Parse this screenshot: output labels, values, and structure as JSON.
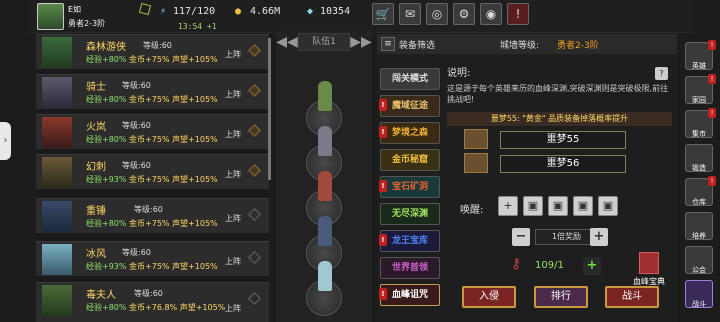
{
  "player": {
    "name": "E如",
    "rank": "勇者2-3阶",
    "stamina": "117/120",
    "gold": "4.66M",
    "gems": "10354",
    "timer": "13:54",
    "regen": "+1"
  },
  "top_icons": [
    "shop-cart-icon",
    "mail-icon",
    "gamepad-icon",
    "gear-icon",
    "color-wheel-icon",
    "notice-icon"
  ],
  "heroes": [
    {
      "name": "森林游侠",
      "level": "等级:60",
      "exp": "经验+80%",
      "gold": "金币+75%",
      "fame": "声望+105%",
      "action": "上阵",
      "active": true
    },
    {
      "name": "骑士",
      "level": "等级:60",
      "exp": "经验+80%",
      "gold": "金币+75%",
      "fame": "声望+105%",
      "action": "上阵",
      "active": true
    },
    {
      "name": "火岚",
      "level": "等级:60",
      "exp": "经验+80%",
      "gold": "金币+75%",
      "fame": "声望+105%",
      "action": "上阵",
      "active": true
    },
    {
      "name": "幻刺",
      "level": "等级:60",
      "exp": "经验+93%",
      "gold": "金币+75%",
      "fame": "声望+105%",
      "action": "上阵",
      "active": true
    },
    {
      "name": "重锤",
      "level": "等级:60",
      "exp": "经验+80%",
      "gold": "金币+75%",
      "fame": "声望+105%",
      "action": "上阵",
      "active": false
    },
    {
      "name": "冰风",
      "level": "等级:60",
      "exp": "经验+93%",
      "gold": "金币+75%",
      "fame": "声望+105%",
      "action": "上阵",
      "active": false
    },
    {
      "name": "毒夫人",
      "level": "等级:60",
      "exp": "经验+80%",
      "gold": "金币+76.8%",
      "fame": "声望+105%",
      "action": "上阵",
      "active": false
    }
  ],
  "team": {
    "label": "队伍1",
    "prev": "◀◀",
    "next": "▶▶"
  },
  "filter": {
    "title": "装备筛选",
    "castle_label": "城墙等级:",
    "castle_value": "勇者2-3阶"
  },
  "modes": [
    {
      "label": "闯关模式",
      "color": "#e0e0e0",
      "bg": "#3a3a3a",
      "badge": false
    },
    {
      "label": "魔域征途",
      "color": "#e8c070",
      "bg": "#3a2a1a",
      "badge": true
    },
    {
      "label": "梦境之森",
      "color": "#f0b030",
      "bg": "#3a2a14",
      "badge": true
    },
    {
      "label": "金币秘窟",
      "color": "#f0c040",
      "bg": "#3a3014",
      "badge": false
    },
    {
      "label": "宝石矿洞",
      "color": "#e06030",
      "bg": "#1a3a3a",
      "badge": true
    },
    {
      "label": "无尽深渊",
      "color": "#a0e060",
      "bg": "#1a2a1a",
      "badge": false
    },
    {
      "label": "龙王宝库",
      "color": "#5080f0",
      "bg": "#1a1a3a",
      "badge": true
    },
    {
      "label": "世界首领",
      "color": "#d060d0",
      "bg": "#2a1a2a",
      "badge": false
    },
    {
      "label": "血峰诅咒",
      "color": "#ffffff",
      "bg": "#3a1a1a",
      "badge": true
    }
  ],
  "desc": {
    "heading": "说明:",
    "body": "这是源于每个英雄来历的血峰深渊,突破深渊则是突破极限,前往挑战吧!"
  },
  "drop_note": "噩梦55: \"黄金\" 品质装备掉落概率提升",
  "dreams": [
    "噩梦55",
    "噩梦56"
  ],
  "wake_label": "唤醒:",
  "multiplier": "1倍奖励",
  "attempts": "109/1",
  "codex_label": "血峰宝典",
  "actions": {
    "invade": "入侵",
    "rank": "排行",
    "battle": "战斗"
  },
  "side_nav": [
    {
      "label": "英雄",
      "badge": true
    },
    {
      "label": "家园",
      "badge": true
    },
    {
      "label": "集市",
      "badge": true
    },
    {
      "label": "锻造",
      "badge": false
    },
    {
      "label": "仓库",
      "badge": true
    },
    {
      "label": "培养",
      "badge": false
    },
    {
      "label": "公会",
      "badge": false
    },
    {
      "label": "战斗",
      "badge": false
    }
  ]
}
